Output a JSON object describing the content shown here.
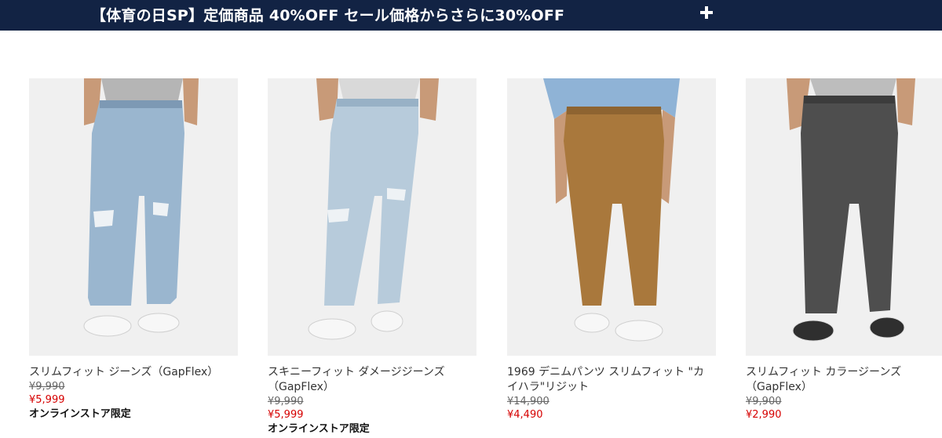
{
  "banner": {
    "text": "【体育の日SP】定価商品 40%OFF  セール価格からさらに30%OFF",
    "expand_icon": "plus-icon",
    "background": "#122344"
  },
  "products": [
    {
      "name": "スリムフィット ジーンズ（GapFlex）",
      "original_price": "¥9,990",
      "sale_price": "¥5,999",
      "badge": "オンラインストア限定",
      "denim_color": "#9ab6cf"
    },
    {
      "name": "スキニーフィット ダメージジーンズ（GapFlex）",
      "original_price": "¥9,990",
      "sale_price": "¥5,999",
      "badge": "オンラインストア限定",
      "denim_color": "#b7cbdb"
    },
    {
      "name": "1969 デニムパンツ スリムフィット \"カイハラ\"リジット",
      "original_price": "¥14,900",
      "sale_price": "¥4,490",
      "badge": "",
      "denim_color": "#a9783c"
    },
    {
      "name": "スリムフィット カラージーンズ（GapFlex）",
      "original_price": "¥9,900",
      "sale_price": "¥2,990",
      "badge": "",
      "denim_color": "#4e4e4e"
    }
  ]
}
